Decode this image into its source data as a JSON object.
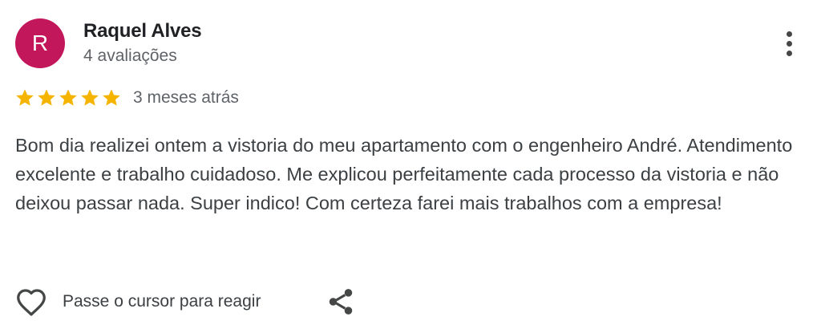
{
  "review": {
    "avatar_initial": "R",
    "reviewer_name": "Raquel Alves",
    "reviewer_count": "4 avaliações",
    "rating": 5,
    "rating_max": 5,
    "date": "3 meses atrás",
    "text": "Bom dia realizei ontem a vistoria do meu apartamento com o engenheiro André. Atendimento excelente e trabalho cuidadoso. Me explicou perfeitamente cada processo da vistoria e não deixou passar nada. Super indico! Com certeza farei mais trabalhos com a empresa!",
    "react_hint": "Passe o cursor para reagir"
  },
  "icons": {
    "more": "more-vert-icon",
    "star": "star-icon",
    "like": "heart-outline-icon",
    "share": "share-icon"
  },
  "colors": {
    "avatar_bg": "#c2185b",
    "star": "#f4b400",
    "name": "#202124",
    "secondary_text": "#5f6368",
    "body_text": "#3c4043",
    "icon": "#444746"
  }
}
